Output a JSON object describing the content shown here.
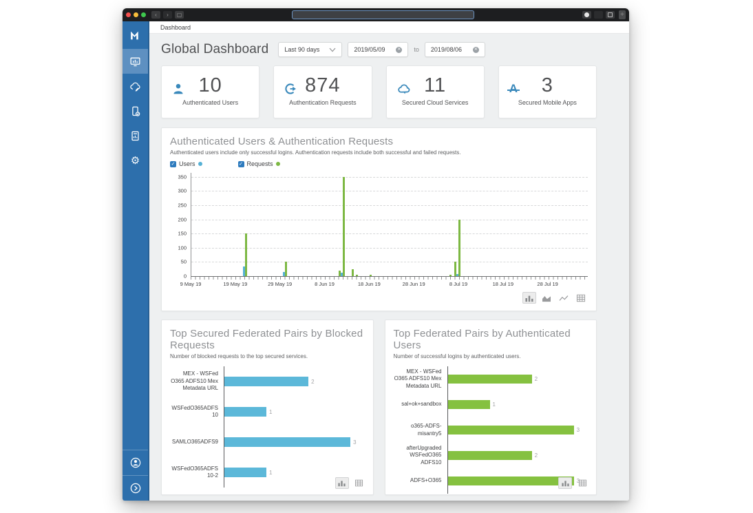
{
  "window": {
    "breadcrumb": "Dashboard",
    "address_bar_value": "",
    "traffic_lights": {
      "close": "#f5504e",
      "minimize": "#f6bd3b",
      "zoom": "#3ec94e"
    },
    "new_tab_label": "+"
  },
  "sidebar": {
    "accent_color": "#2d6fac",
    "selected_color": "#5e90c1",
    "items": [
      {
        "icon": "dashboard-icon",
        "selected": true
      },
      {
        "icon": "cloud-edit-icon",
        "selected": false
      },
      {
        "icon": "mobile-device-icon",
        "selected": false
      },
      {
        "icon": "report-icon",
        "selected": false
      },
      {
        "icon": "settings-gear-icon",
        "selected": false
      }
    ],
    "bottom_items": [
      {
        "icon": "user-profile-icon"
      },
      {
        "icon": "expand-chevron-icon"
      }
    ]
  },
  "header": {
    "title": "Global Dashboard",
    "range_select": "Last 90 days",
    "date_from": "2019/05/09",
    "to_label": "to",
    "date_to": "2019/08/06"
  },
  "stats": [
    {
      "icon": "user-icon",
      "value": "10",
      "label": "Authenticated Users"
    },
    {
      "icon": "auth-request-icon",
      "value": "874",
      "label": "Authentication Requests"
    },
    {
      "icon": "cloud-icon",
      "value": "11",
      "label": "Secured Cloud Services"
    },
    {
      "icon": "mobile-app-icon",
      "value": "3",
      "label": "Secured Mobile Apps"
    }
  ],
  "main_chart": {
    "title": "Authenticated Users & Authentication Requests",
    "subtitle": "Authenticated users include only successful logins. Authentication requests include both successful and failed requests.",
    "legend": [
      {
        "label": "Users",
        "color": "#56b1d5",
        "checked": true
      },
      {
        "label": "Requests",
        "color": "#7db843",
        "checked": true
      }
    ]
  },
  "panels": {
    "blocked": {
      "title": "Top Secured Federated Pairs by Blocked Requests",
      "subtitle": "Number of blocked requests to the top secured services."
    },
    "auth_users": {
      "title": "Top Federated Pairs by Authenticated Users",
      "subtitle": "Number of successful logins by authenticated users."
    }
  },
  "chart_data": [
    {
      "type": "bar",
      "title": "Authenticated Users & Authentication Requests",
      "xlabel": "",
      "ylabel": "",
      "ylim": [
        0,
        350
      ],
      "yticks": [
        0,
        50,
        100,
        150,
        200,
        250,
        300,
        350
      ],
      "grid": true,
      "legend_position": "top",
      "x_domain_days": 89,
      "x_ticks": [
        {
          "day": 0,
          "label": "9 May 19"
        },
        {
          "day": 10,
          "label": "19 May 19"
        },
        {
          "day": 20,
          "label": "29 May 19"
        },
        {
          "day": 30,
          "label": "8 Jun 19"
        },
        {
          "day": 40,
          "label": "18 Jun 19"
        },
        {
          "day": 50,
          "label": "28 Jun 19"
        },
        {
          "day": 60,
          "label": "8 Jul 19"
        },
        {
          "day": 70,
          "label": "18 Jul 19"
        },
        {
          "day": 80,
          "label": "28 Jul 19"
        }
      ],
      "series": [
        {
          "name": "Users",
          "color": "#56b1d5",
          "points": [
            {
              "day": 12,
              "value": 35
            },
            {
              "day": 21,
              "value": 15
            },
            {
              "day": 34,
              "value": 12
            },
            {
              "day": 60,
              "value": 8
            }
          ]
        },
        {
          "name": "Requests",
          "color": "#7db843",
          "points": [
            {
              "day": 12,
              "value": 150
            },
            {
              "day": 21,
              "value": 50
            },
            {
              "day": 33,
              "value": 20
            },
            {
              "day": 34,
              "value": 350
            },
            {
              "day": 36,
              "value": 25
            },
            {
              "day": 37,
              "value": 6
            },
            {
              "day": 40,
              "value": 4
            },
            {
              "day": 58,
              "value": 5
            },
            {
              "day": 59,
              "value": 50
            },
            {
              "day": 60,
              "value": 200
            }
          ]
        }
      ]
    },
    {
      "type": "bar",
      "orientation": "horizontal",
      "title": "Top Secured Federated Pairs by Blocked Requests",
      "categories": [
        "MEX - WSFed O365 ADFS10 Mex Metadata URL",
        "WSFedO365ADFS10",
        "SAMLO365ADFS9",
        "WSFedO365ADFS10-2"
      ],
      "values": [
        2,
        1,
        3,
        1
      ],
      "xlim": [
        0,
        3
      ],
      "color": "#5cb8d9"
    },
    {
      "type": "bar",
      "orientation": "horizontal",
      "title": "Top Federated Pairs by Authenticated Users",
      "categories": [
        "MEX - WSFed O365 ADFS10 Mex Metadata URL",
        "sal+ok+sandbox",
        "o365-ADFS-misantry5",
        "afterUpgraded WSFedO365 ADFS10",
        "ADFS+O365"
      ],
      "values": [
        2,
        1,
        3,
        2,
        3
      ],
      "xlim": [
        0,
        3
      ],
      "color": "#85c140"
    }
  ]
}
